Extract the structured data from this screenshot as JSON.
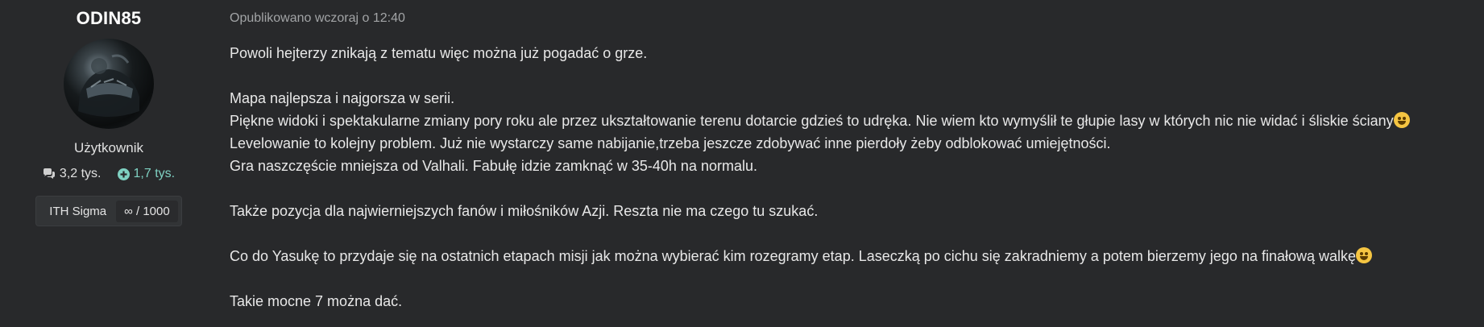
{
  "author": {
    "username": "ODIN85",
    "role": "Użytkownik",
    "posts_count": "3,2 tys.",
    "reputation": "1,7 tys.",
    "badge": {
      "name": "ITH Sigma",
      "value": "∞ / 1000"
    },
    "icons": {
      "posts": "speech-bubbles-icon",
      "reputation": "plus-circle-icon"
    },
    "colors": {
      "reputation": "#7fd1c2"
    }
  },
  "post": {
    "meta": "Opublikowano wczoraj o 12:40",
    "lines": [
      "Powoli hejterzy znikają z tematu więc można już pogadać o grze.",
      "",
      "Mapa najlepsza i najgorsza w serii.",
      "Piękne widoki i spektakularne zmiany pory roku ale przez ukształtowanie terenu dotarcie gdzieś to udręka. Nie wiem kto wymyślił te głupie lasy w których nic nie widać i śliskie ściany",
      "Levelowanie to kolejny problem. Już nie wystarczy same nabijanie,trzeba jeszcze zdobywać inne pierdoły żeby odblokować umiejętności.",
      " Gra naszczęście mniejsza od Valhali. Fabułę idzie zamknąć w 35-40h na normalu.",
      "",
      " Także pozycja dla najwierniejszych fanów i miłośników Azji. Reszta nie ma czego tu szukać.",
      "",
      "Co do Yasukę to przydaje się na ostatnich etapach misji jak można wybierać kim rozegramy etap. Laseczką po cichu się zakradniemy a potem bierzemy jego na finałową walkę",
      "",
      "Takie mocne 7 można dać."
    ]
  }
}
